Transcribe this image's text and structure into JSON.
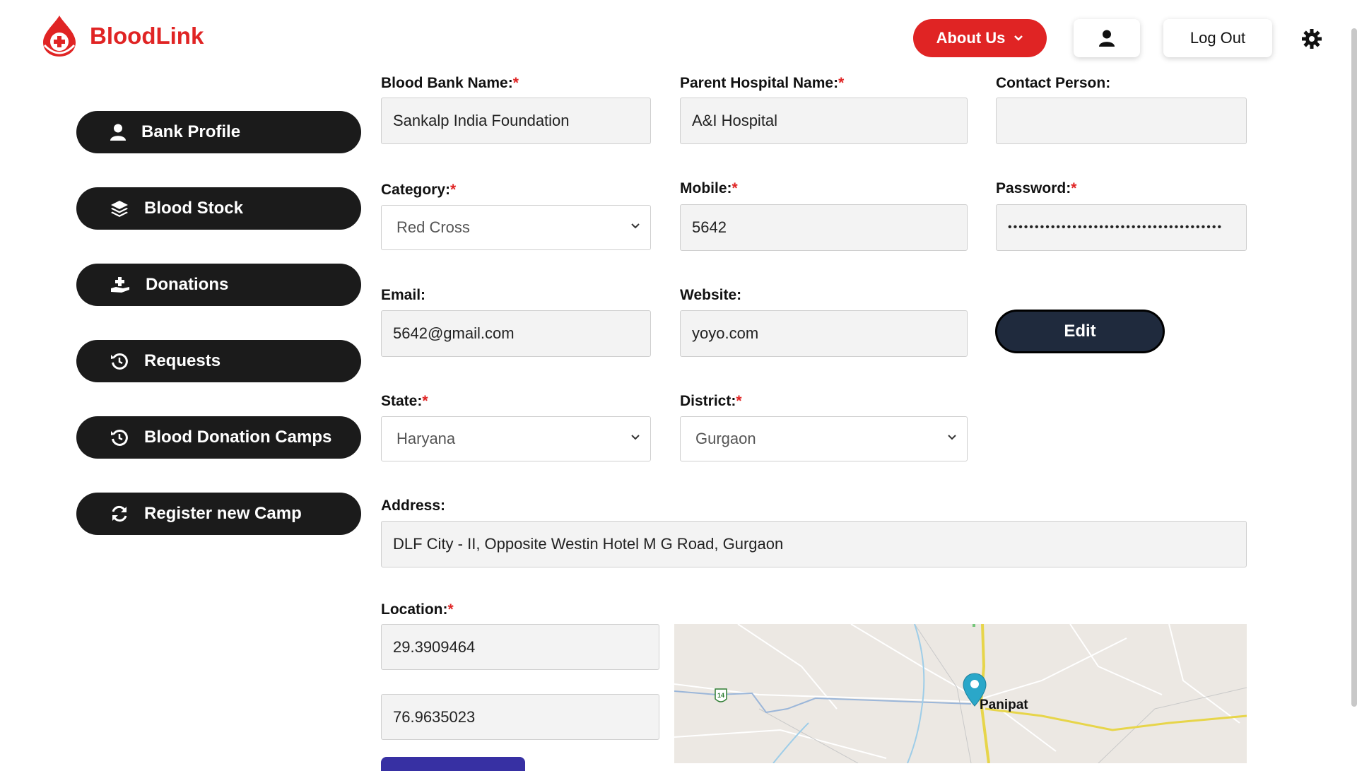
{
  "header": {
    "brand": "BloodLink",
    "about_label": "About Us",
    "logout_label": "Log Out"
  },
  "sidebar": {
    "items": [
      {
        "label": "Bank Profile",
        "icon": "user-icon"
      },
      {
        "label": "Blood Stock",
        "icon": "layers-icon"
      },
      {
        "label": "Donations",
        "icon": "hand-holding-plus-icon"
      },
      {
        "label": "Requests",
        "icon": "history-icon"
      },
      {
        "label": "Blood Donation Camps",
        "icon": "history-icon"
      },
      {
        "label": "Register new Camp",
        "icon": "refresh-icon"
      }
    ]
  },
  "form": {
    "bank_name": {
      "label": "Blood Bank Name:",
      "value": "Sankalp India Foundation"
    },
    "parent_hospital": {
      "label": "Parent Hospital Name:",
      "value": "A&I Hospital"
    },
    "contact_person": {
      "label": "Contact Person:",
      "value": ""
    },
    "category": {
      "label": "Category:",
      "value": "Red Cross"
    },
    "mobile": {
      "label": "Mobile:",
      "value": "5642"
    },
    "password": {
      "label": "Password:",
      "value": "••••••••••••••••••••••••••••••••••••••••"
    },
    "email": {
      "label": "Email:",
      "value": "5642@gmail.com"
    },
    "website": {
      "label": "Website:",
      "value": "yoyo.com"
    },
    "edit_label": "Edit",
    "state": {
      "label": "State:",
      "value": "Haryana"
    },
    "district": {
      "label": "District:",
      "value": "Gurgaon"
    },
    "address": {
      "label": "Address:",
      "value": "DLF City - II, Opposite Westin Hotel M G Road, Gurgaon"
    },
    "location": {
      "label": "Location:",
      "latitude": "29.3909464",
      "longitude": "76.9635023"
    },
    "required_mark": "*"
  },
  "map": {
    "city_label": "Panipat",
    "highway_label": "14"
  },
  "colors": {
    "brand_red": "#e02424",
    "sidebar_bg": "#1b1b1b",
    "edit_bg": "#1f2a3d",
    "marker": "#2aa7c9"
  }
}
